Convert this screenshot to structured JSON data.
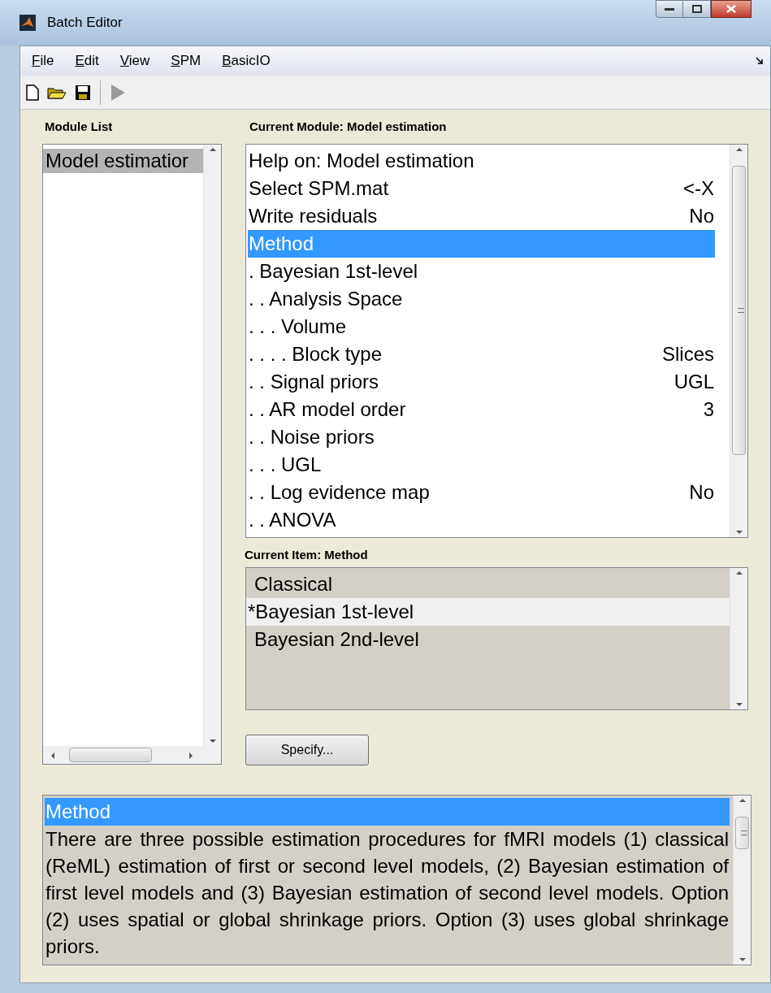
{
  "window": {
    "title": "Batch Editor"
  },
  "menu": [
    {
      "label": "File"
    },
    {
      "label": "Edit"
    },
    {
      "label": "View"
    },
    {
      "label": "SPM"
    },
    {
      "label": "BasicIO"
    }
  ],
  "module_list": {
    "heading": "Module List",
    "items": [
      {
        "label": "Model estimatior",
        "selected": true
      }
    ]
  },
  "current_module": {
    "heading": "Current Module: Model estimation",
    "items": [
      {
        "label": "Help on: Model estimation",
        "selected": false
      },
      {
        "label": "Select SPM.mat",
        "value": "<-X",
        "selected": false
      },
      {
        "label": "Write residuals",
        "value": "No",
        "selected": false
      },
      {
        "label": "Method",
        "selected": true
      },
      {
        "label": ". Bayesian 1st-level",
        "selected": false
      },
      {
        "label": ". . Analysis Space",
        "selected": false
      },
      {
        "label": ". . . Volume",
        "selected": false
      },
      {
        "label": ". . . . Block type",
        "value": "Slices",
        "selected": false
      },
      {
        "label": ". . Signal priors",
        "value": "UGL",
        "selected": false
      },
      {
        "label": ". . AR model order",
        "value": "3",
        "selected": false
      },
      {
        "label": ". . Noise priors",
        "selected": false
      },
      {
        "label": ". . . UGL",
        "selected": false
      },
      {
        "label": ". . Log evidence map",
        "value": "No",
        "selected": false
      },
      {
        "label": ". . ANOVA",
        "selected": false
      }
    ]
  },
  "current_item": {
    "heading": "Current Item: Method",
    "options": [
      {
        "label": "Classical",
        "selected": false
      },
      {
        "label": "*Bayesian 1st-level",
        "selected": true
      },
      {
        "label": "Bayesian 2nd-level",
        "selected": false
      }
    ]
  },
  "specify_button": "Specify...",
  "help": {
    "title": "Method",
    "text": "There are three possible estimation procedures for fMRI models (1) classical (ReML) estimation of first or second level models, (2) Bayesian estimation of first level models and (3) Bayesian estimation of second level models. Option (2) uses spatial or global shrinkage priors. Option (3) uses global shrinkage priors."
  }
}
